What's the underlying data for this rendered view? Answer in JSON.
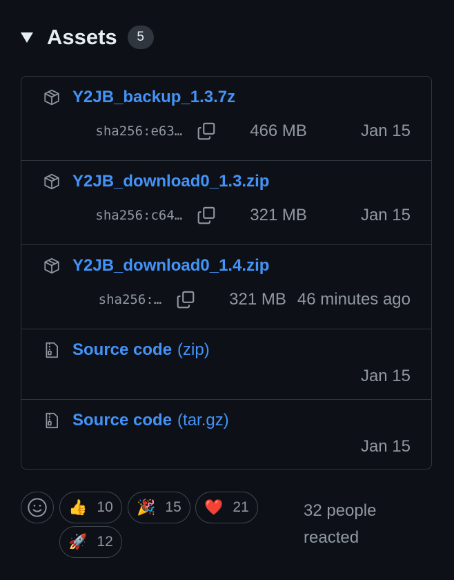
{
  "assets_section": {
    "title": "Assets",
    "count": "5"
  },
  "assets": [
    {
      "name": "Y2JB_backup_1.3.7z",
      "sha": "sha256:e63…",
      "size": "466 MB",
      "date": "Jan 15",
      "icon": "package-icon"
    },
    {
      "name": "Y2JB_download0_1.3.zip",
      "sha": "sha256:c64…",
      "size": "321 MB",
      "date": "Jan 15",
      "icon": "package-icon"
    },
    {
      "name": "Y2JB_download0_1.4.zip",
      "sha": "sha256:…",
      "size": "321 MB",
      "date": "46 minutes ago",
      "icon": "package-icon"
    }
  ],
  "sources": [
    {
      "name": "Source code",
      "ext": "(zip)",
      "date": "Jan 15",
      "icon": "file-zip-icon"
    },
    {
      "name": "Source code",
      "ext": "(tar.gz)",
      "date": "Jan 15",
      "icon": "file-zip-icon"
    }
  ],
  "reactions": {
    "items": [
      {
        "emoji": "👍",
        "count": "10",
        "icon": "thumbs-up-icon"
      },
      {
        "emoji": "🎉",
        "count": "15",
        "icon": "party-popper-icon"
      },
      {
        "emoji": "❤️",
        "count": "21",
        "icon": "heart-icon"
      },
      {
        "emoji": "🚀",
        "count": "12",
        "icon": "rocket-icon"
      }
    ],
    "summary": "32 people reacted"
  },
  "colors": {
    "background": "#0d1117",
    "link": "#4493f8",
    "muted": "#9198a1",
    "border": "#30363d"
  }
}
